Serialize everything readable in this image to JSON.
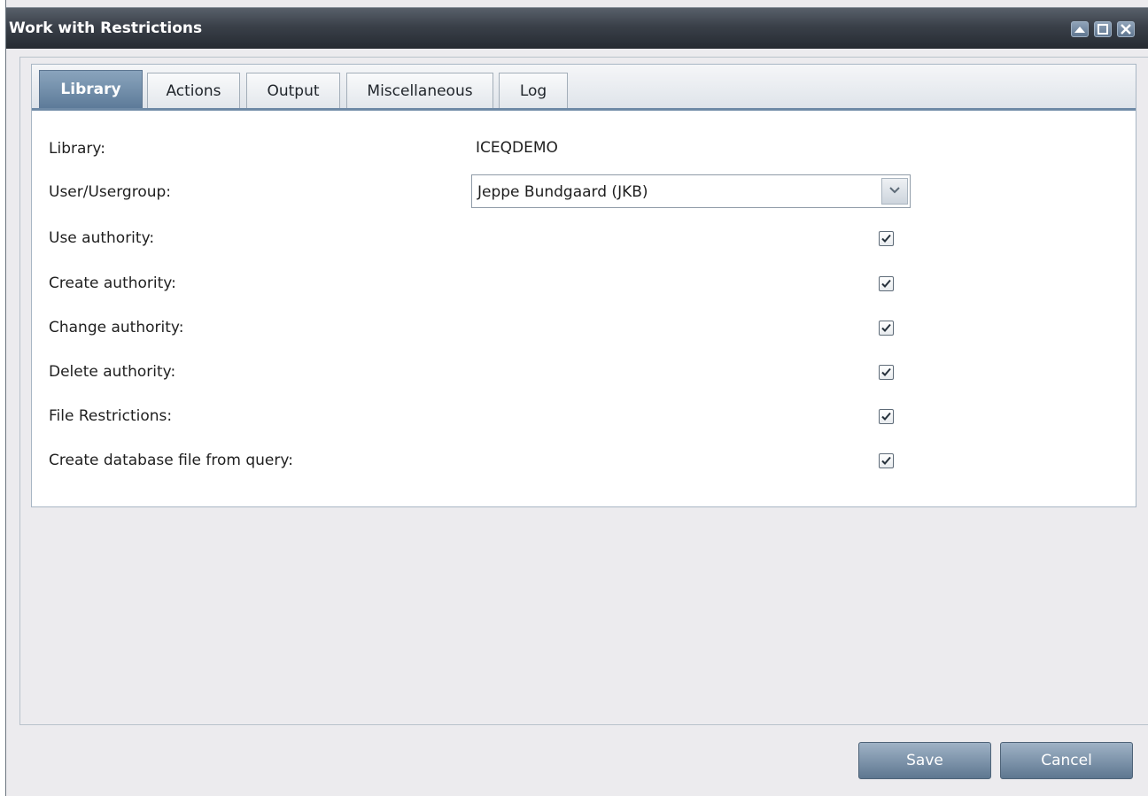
{
  "window": {
    "title": "Work with Restrictions"
  },
  "tabs": [
    {
      "label": "Library",
      "active": true
    },
    {
      "label": "Actions",
      "active": false
    },
    {
      "label": "Output",
      "active": false
    },
    {
      "label": "Miscellaneous",
      "active": false
    },
    {
      "label": "Log",
      "active": false
    }
  ],
  "form": {
    "library": {
      "label": "Library:",
      "value": "ICEQDEMO"
    },
    "user": {
      "label": "User/Usergroup:",
      "selected": "Jeppe Bundgaard (JKB)"
    },
    "use_authority": {
      "label": "Use authority:",
      "checked": true
    },
    "create_authority": {
      "label": "Create authority:",
      "checked": true
    },
    "change_authority": {
      "label": "Change authority:",
      "checked": true
    },
    "delete_authority": {
      "label": "Delete authority:",
      "checked": true
    },
    "file_restrictions": {
      "label": "File Restrictions:",
      "checked": true
    },
    "create_db_file": {
      "label": "Create database file from query:",
      "checked": true
    }
  },
  "buttons": {
    "save": "Save",
    "cancel": "Cancel"
  },
  "colors": {
    "title_bar": "#2f353d",
    "active_tab": "#6f8aa6",
    "button": "#7890a8"
  }
}
